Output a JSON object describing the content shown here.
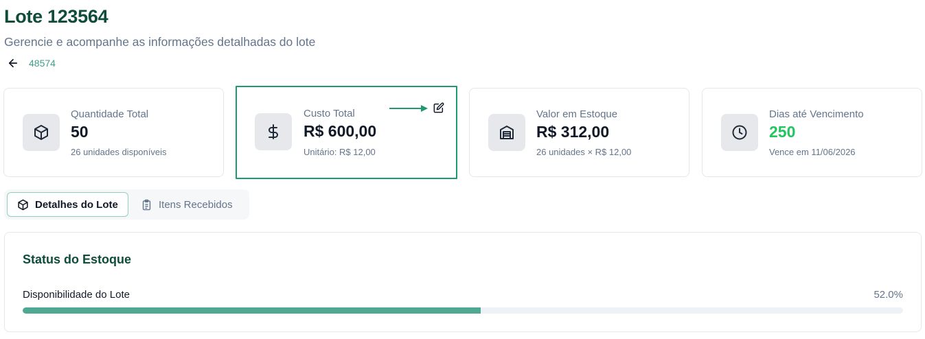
{
  "header": {
    "title": "Lote 123564",
    "subtitle": "Gerencie e acompanhe as informações detalhadas do lote",
    "back_link": "48574"
  },
  "cards": [
    {
      "label": "Quantidade Total",
      "value": "50",
      "sub": "26 unidades disponíveis",
      "icon": "package-icon"
    },
    {
      "label": "Custo Total",
      "value": "R$ 600,00",
      "sub": "Unitário: R$ 12,00",
      "icon": "dollar-icon",
      "highlighted": true,
      "action_icon": "edit-icon"
    },
    {
      "label": "Valor em Estoque",
      "value": "R$ 312,00",
      "sub": "26 unidades × R$ 12,00",
      "icon": "warehouse-icon"
    },
    {
      "label": "Dias até Vencimento",
      "value": "250",
      "sub": "Vence em 11/06/2026",
      "icon": "clock-icon"
    }
  ],
  "tabs": [
    {
      "label": "Detalhes do Lote",
      "icon": "package-icon",
      "active": true
    },
    {
      "label": "Itens Recebidos",
      "icon": "clipboard-icon",
      "active": false
    }
  ],
  "status": {
    "title": "Status do Estoque",
    "availability_label": "Disponibilidade do Lote",
    "availability_percent": "52.0%",
    "availability_fraction": 0.52
  },
  "colors": {
    "brand_dark": "#0f4c3a",
    "accent": "#1f9a6f",
    "progress": "#4fa891",
    "days_value": "#22c55e"
  }
}
